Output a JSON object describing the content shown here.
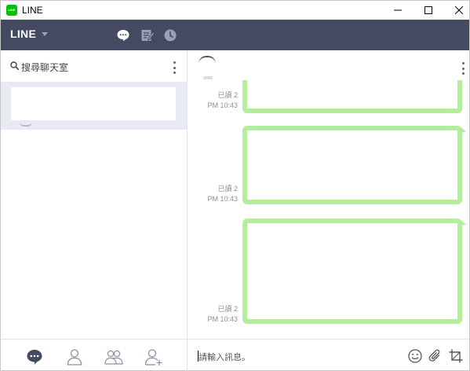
{
  "window": {
    "title": "LINE",
    "logo_text": "LINE"
  },
  "topbar": {
    "brand_label": "LINE",
    "icons": [
      "chat-bubble-icon",
      "note-icon",
      "clock-icon"
    ]
  },
  "sidebar": {
    "search_placeholder": "搜尋聊天室",
    "footer_icons": [
      "chats-tab-icon",
      "friend-icon",
      "group-icon",
      "add-friend-icon"
    ]
  },
  "chat": {
    "messages": [
      {
        "read_label": "已讀 2",
        "time": "PM 10:43"
      },
      {
        "read_label": "已讀 2",
        "time": "PM 10:43"
      },
      {
        "read_label": "已讀 2",
        "time": "PM 10:43"
      }
    ],
    "input_placeholder": "請輸入訊息。",
    "input_icons": [
      "emoji-icon",
      "attach-icon",
      "crop-icon"
    ]
  },
  "colors": {
    "topbar_bg": "#434a61",
    "bubble_border": "#b4ee9c",
    "selected_chat_bg": "#e9ebf3",
    "line_green": "#00c300"
  }
}
